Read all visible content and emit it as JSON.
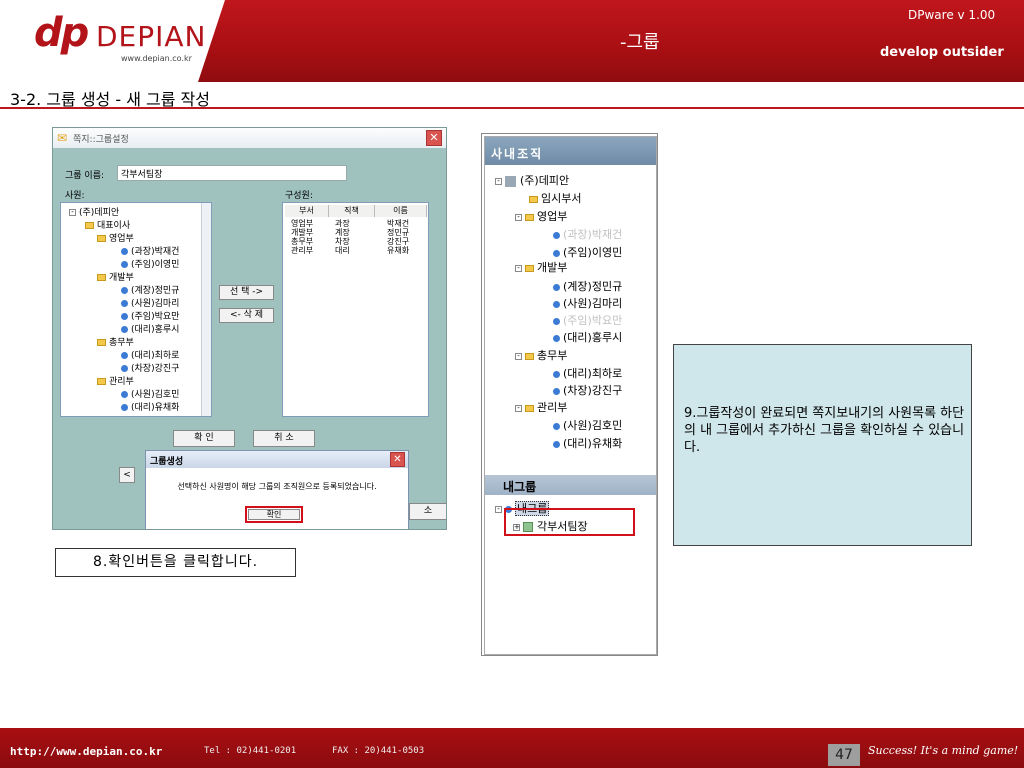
{
  "header": {
    "logo_mark": "dp",
    "logo_name": "DEPIAN",
    "logo_url": "www.depian.co.kr",
    "center_title": "-그룹",
    "version": "DPware v 1.00",
    "slogan": "develop outsider"
  },
  "section_title": "3-2. 그룹 생성 - 새 그룹 작성",
  "dialog": {
    "title": "쪽지::그룹설정",
    "group_name_label": "그룹 이름:",
    "group_name_value": "각부서팀장",
    "employees_label": "사원:",
    "members_label": "구성원:",
    "employee_tree": [
      {
        "label": "(주)데피안",
        "kind": "root"
      },
      {
        "label": "대표이사",
        "kind": "folder"
      },
      {
        "label": "영업부",
        "kind": "folder"
      },
      {
        "label": "(과장)박재건",
        "kind": "person"
      },
      {
        "label": "(주임)이영민",
        "kind": "person"
      },
      {
        "label": "개발부",
        "kind": "folder"
      },
      {
        "label": "(계장)정민규",
        "kind": "person"
      },
      {
        "label": "(사원)김마리",
        "kind": "person"
      },
      {
        "label": "(주임)박요만",
        "kind": "person"
      },
      {
        "label": "(대리)홍루시",
        "kind": "person"
      },
      {
        "label": "총무부",
        "kind": "folder"
      },
      {
        "label": "(대리)최하로",
        "kind": "person"
      },
      {
        "label": "(차장)강진구",
        "kind": "person"
      },
      {
        "label": "관리부",
        "kind": "folder"
      },
      {
        "label": "(사원)김호민",
        "kind": "person"
      },
      {
        "label": "(대리)유채화",
        "kind": "person"
      }
    ],
    "member_columns": [
      "부서",
      "직책",
      "이름"
    ],
    "member_rows": [
      [
        "영업부",
        "과장",
        "박재건"
      ],
      [
        "개발부",
        "계장",
        "정민규"
      ],
      [
        "총무부",
        "차장",
        "강진구"
      ],
      [
        "관리부",
        "대리",
        "유채화"
      ]
    ],
    "add_button": "선 택 ->",
    "remove_button": "<- 삭 제",
    "ok_button": "확 인",
    "cancel_button": "취 소",
    "bottom_right_button": "소",
    "bottom_left_button": "<"
  },
  "sub_dialog": {
    "title": "그룹생성",
    "message": "선택하신 사원명이 해당 그룹의 조직원으로 등록되었습니다.",
    "ok_button": "확인"
  },
  "callout_left": "8.확인버튼을 클릭합니다.",
  "org_panel": {
    "header": "사내조직",
    "tree": [
      {
        "label": "(주)데피안",
        "faded": false
      },
      {
        "label": "임시부서",
        "faded": false
      },
      {
        "label": "영업부",
        "faded": false
      },
      {
        "label": "(과장)박재건",
        "faded": true
      },
      {
        "label": "(주임)이영민",
        "faded": false
      },
      {
        "label": "개발부",
        "faded": false
      },
      {
        "label": "(계장)정민규",
        "faded": false
      },
      {
        "label": "(사원)김마리",
        "faded": false
      },
      {
        "label": "(주임)박요만",
        "faded": true
      },
      {
        "label": "(대리)홍루시",
        "faded": false
      },
      {
        "label": "총무부",
        "faded": false
      },
      {
        "label": "(대리)최하로",
        "faded": false
      },
      {
        "label": "(차장)강진구",
        "faded": false
      },
      {
        "label": "관리부",
        "faded": false
      },
      {
        "label": "(사원)김호민",
        "faded": false
      },
      {
        "label": "(대리)유채화",
        "faded": false
      }
    ],
    "my_group_header": "내그룹",
    "my_group_root": "내그룹",
    "my_group_item": "각부서팀장"
  },
  "callout_right": "9.그룹작성이 완료되면 쪽지보내기의 사원목록 하단의 내 그룹에서 추가하신 그룹을 확인하실 수 있습니다.",
  "footer": {
    "url": "http://www.depian.co.kr",
    "tel": "Tel : 02)441-0201",
    "fax": "FAX : 20)441-0503",
    "page": "47",
    "tagline": "Success! It's a mind game!"
  },
  "colors": {
    "brand_red": "#b3141a",
    "dialog_bg": "#9fc2bf",
    "callout_bg": "#cfe6ea",
    "highlight_border": "#d0111a"
  }
}
